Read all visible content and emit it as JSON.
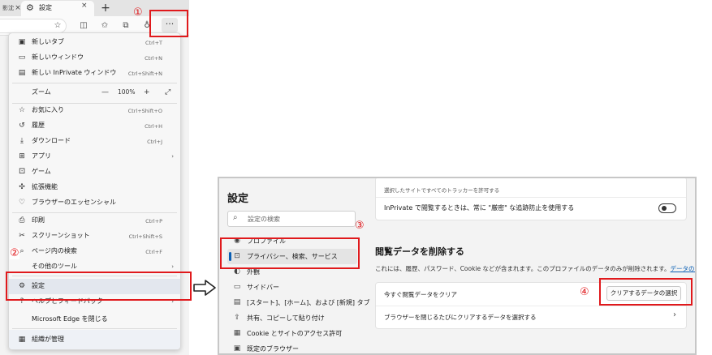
{
  "browser": {
    "partial_tab_text": "影沈",
    "active_tab_title": "設定",
    "tab_close_glyph": "×",
    "new_tab_glyph": "+",
    "more_glyph": "···"
  },
  "menu": {
    "items": [
      {
        "icon": "new-tab-icon",
        "glyph": "▣",
        "label": "新しいタブ",
        "shortcut": "Ctrl+T"
      },
      {
        "icon": "new-window-icon",
        "glyph": "▭",
        "label": "新しいウィンドウ",
        "shortcut": "Ctrl+N"
      },
      {
        "icon": "inprivate-icon",
        "glyph": "▤",
        "label": "新しい InPrivate ウィンドウ",
        "shortcut": "Ctrl+Shift+N"
      },
      {
        "icon": "favorites-icon",
        "glyph": "☆",
        "label": "お気に入り",
        "shortcut": "Ctrl+Shift+O"
      },
      {
        "icon": "history-icon",
        "glyph": "↺",
        "label": "履歴",
        "shortcut": "Ctrl+H"
      },
      {
        "icon": "download-icon",
        "glyph": "⤓",
        "label": "ダウンロード",
        "shortcut": "Ctrl+J"
      },
      {
        "icon": "apps-icon",
        "glyph": "⊞",
        "label": "アプリ",
        "shortcut": ""
      },
      {
        "icon": "games-icon",
        "glyph": "⚀",
        "label": "ゲーム",
        "shortcut": ""
      },
      {
        "icon": "extensions-icon",
        "glyph": "✣",
        "label": "拡張機能",
        "shortcut": ""
      },
      {
        "icon": "essentials-icon",
        "glyph": "♡",
        "label": "ブラウザーのエッセンシャル",
        "shortcut": ""
      },
      {
        "icon": "print-icon",
        "glyph": "⎙",
        "label": "印刷",
        "shortcut": "Ctrl+P"
      },
      {
        "icon": "screenshot-icon",
        "glyph": "✂",
        "label": "スクリーンショット",
        "shortcut": "Ctrl+Shift+S"
      },
      {
        "icon": "find-icon",
        "glyph": "⌕",
        "label": "ページ内の検索",
        "shortcut": "Ctrl+F"
      },
      {
        "icon": "more-tools-icon",
        "glyph": "",
        "label": "その他のツール",
        "shortcut": ""
      },
      {
        "icon": "settings-icon",
        "glyph": "⚙",
        "label": "設定",
        "shortcut": ""
      },
      {
        "icon": "help-icon",
        "glyph": "?",
        "label": "ヘルプとフィードバック",
        "shortcut": ""
      },
      {
        "icon": "",
        "glyph": "",
        "label": "Microsoft Edge を閉じる",
        "shortcut": ""
      },
      {
        "icon": "managed-icon",
        "glyph": "▦",
        "label": "組織が管理",
        "shortcut": ""
      }
    ],
    "zoom": {
      "label": "ズーム",
      "minus": "—",
      "value": "100%",
      "plus": "+",
      "fullscreen": "⤢"
    },
    "submenu_arrow": "›"
  },
  "annotations": {
    "n1": "①",
    "n2": "②",
    "n3": "③",
    "n4": "④"
  },
  "settings": {
    "title": "設定",
    "search_placeholder": "設定の検索",
    "nav": [
      {
        "glyph": "◉",
        "icon": "profile-icon",
        "label": "プロファイル"
      },
      {
        "glyph": "🔒",
        "icon": "lock-icon",
        "label": "プライバシー、検索、サービス"
      },
      {
        "glyph": "◐",
        "icon": "appearance-icon",
        "label": "外観"
      },
      {
        "glyph": "▭",
        "icon": "sidebar-icon",
        "label": "サイドバー"
      },
      {
        "glyph": "▤",
        "icon": "start-home-icon",
        "label": "[スタート]、[ホーム]、および [新規] タブ"
      },
      {
        "glyph": "⇪",
        "icon": "share-icon",
        "label": "共有、コピーして貼り付け"
      },
      {
        "glyph": "▦",
        "icon": "cookie-icon",
        "label": "Cookie とサイトのアクセス許可"
      },
      {
        "glyph": "▣",
        "icon": "default-browser-icon",
        "label": "既定のブラウザー"
      }
    ],
    "tracker_note": "選択したサイトですべてのトラッカーを許可する",
    "inprivate_strict": "InPrivate で閲覧するときは、常に \"厳密\" な追跡防止を使用する",
    "section_heading": "閲覧データを削除する",
    "section_desc": "これには、履歴、パスワード、Cookie などが含まれます。このプロファイルのデータのみが削除されます。",
    "manage_data_link": "データの管理",
    "clear_now_label": "今すぐ閲覧データをクリア",
    "clear_button": "クリアするデータの選択",
    "clear_on_close": "ブラウザーを閉じるたびにクリアするデータを選択する",
    "chevron": "›"
  }
}
